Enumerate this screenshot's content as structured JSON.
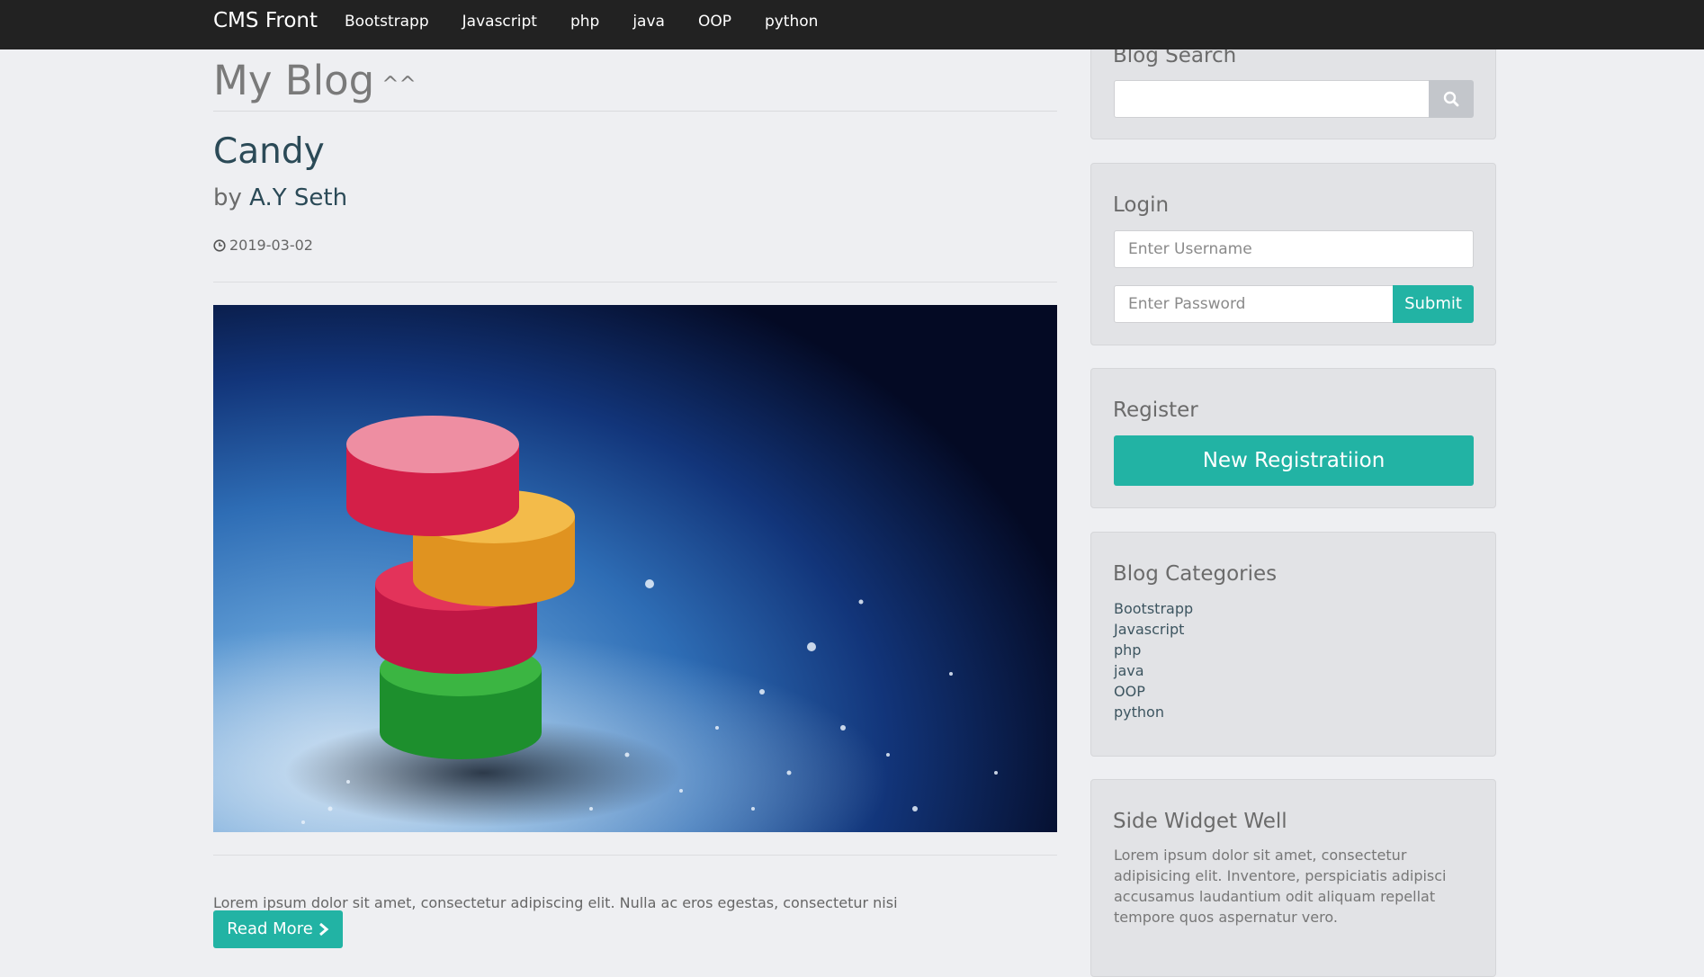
{
  "navbar": {
    "brand": "CMS Front",
    "links": [
      "Bootstrapp",
      "Javascript",
      "php",
      "java",
      "OOP",
      "python"
    ]
  },
  "page": {
    "title": "My Blog",
    "title_suffix": "^^"
  },
  "post": {
    "title": "Candy",
    "author_prefix": "by",
    "author": "A.Y Seth",
    "date": "2019-03-02",
    "image_alt": "stack of colorful sugar candies",
    "excerpt": "Lorem ipsum dolor sit amet, consectetur adipiscing elit. Nulla ac eros egestas, consectetur nisi",
    "read_more_label": "Read More"
  },
  "sidebar": {
    "search": {
      "title": "Blog Search",
      "value": ""
    },
    "login": {
      "title": "Login",
      "username_placeholder": "Enter Username",
      "password_placeholder": "Enter Password",
      "submit_label": "Submit"
    },
    "register": {
      "title": "Register",
      "button_label": "New Registratiion"
    },
    "categories": {
      "title": "Blog Categories",
      "items": [
        "Bootstrapp",
        "Javascript",
        "php",
        "java",
        "OOP",
        "python"
      ]
    },
    "widget": {
      "title": "Side Widget Well",
      "text": "Lorem ipsum dolor sit amet, consectetur adipisicing elit. Inventore, perspiciatis adipisci accusamus laudantium odit aliquam repellat tempore quos aspernatur vero."
    }
  },
  "colors": {
    "navbar_bg": "#222222",
    "accent": "#22b3a4",
    "page_bg": "#eeeff2",
    "well_bg": "#e2e3e6"
  },
  "icons": {
    "search": "search-icon",
    "clock": "clock-icon",
    "read_more": "chevron-right-icon"
  }
}
